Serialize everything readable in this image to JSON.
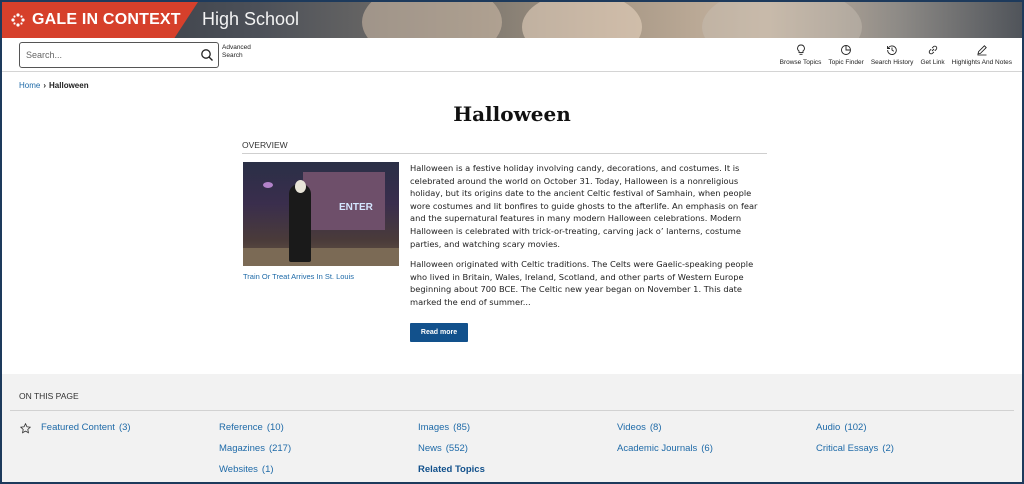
{
  "brand": {
    "name": "GALE IN CONTEXT",
    "edition": "High School",
    "color": "#d6402b"
  },
  "search": {
    "placeholder": "Search...",
    "advanced_label": "Advanced Search"
  },
  "tools": [
    {
      "label": "Browse Topics",
      "icon": "lightbulb-icon"
    },
    {
      "label": "Topic Finder",
      "icon": "topic-finder-icon"
    },
    {
      "label": "Search History",
      "icon": "history-icon"
    },
    {
      "label": "Get Link",
      "icon": "link-icon"
    },
    {
      "label": "Highlights And Notes",
      "icon": "pencil-icon"
    }
  ],
  "breadcrumb": {
    "home": "Home",
    "current": "Halloween"
  },
  "page": {
    "title": "Halloween",
    "overview_label": "OVERVIEW",
    "image_caption": "Train Or Treat Arrives In St. Louis",
    "image_sign_text": "ENTER",
    "paragraphs": [
      "Halloween is a festive holiday involving candy, decorations, and costumes. It is celebrated around the world on October 31. Today, Halloween is a nonreligious holiday, but its origins date to the ancient Celtic festival of Samhain, when people wore costumes and lit bonfires to guide ghosts to the afterlife. An emphasis on fear and the supernatural features in many modern Halloween celebrations. Modern Halloween is celebrated with trick-or-treating, carving jack o’ lanterns, costume parties, and watching scary movies.",
      "Halloween originated with Celtic traditions. The Celts were Gaelic-speaking people who lived in Britain, Wales, Ireland, Scotland, and other parts of Western Europe beginning about 700 BCE. The Celtic new year began on November 1. This date marked the end of summer..."
    ],
    "read_more": "Read more"
  },
  "on_this_page": {
    "heading": "ON THIS PAGE",
    "links": {
      "featured": {
        "label": "Featured Content",
        "count": "(3)"
      },
      "reference": {
        "label": "Reference",
        "count": "(10)"
      },
      "images": {
        "label": "Images",
        "count": "(85)"
      },
      "videos": {
        "label": "Videos",
        "count": "(8)"
      },
      "audio": {
        "label": "Audio",
        "count": "(102)"
      },
      "magazines": {
        "label": "Magazines",
        "count": "(217)"
      },
      "news": {
        "label": "News",
        "count": "(552)"
      },
      "academic": {
        "label": "Academic Journals",
        "count": "(6)"
      },
      "critical": {
        "label": "Critical Essays",
        "count": "(2)"
      },
      "websites": {
        "label": "Websites",
        "count": "(1)"
      },
      "related": {
        "label": "Related Topics"
      }
    }
  }
}
